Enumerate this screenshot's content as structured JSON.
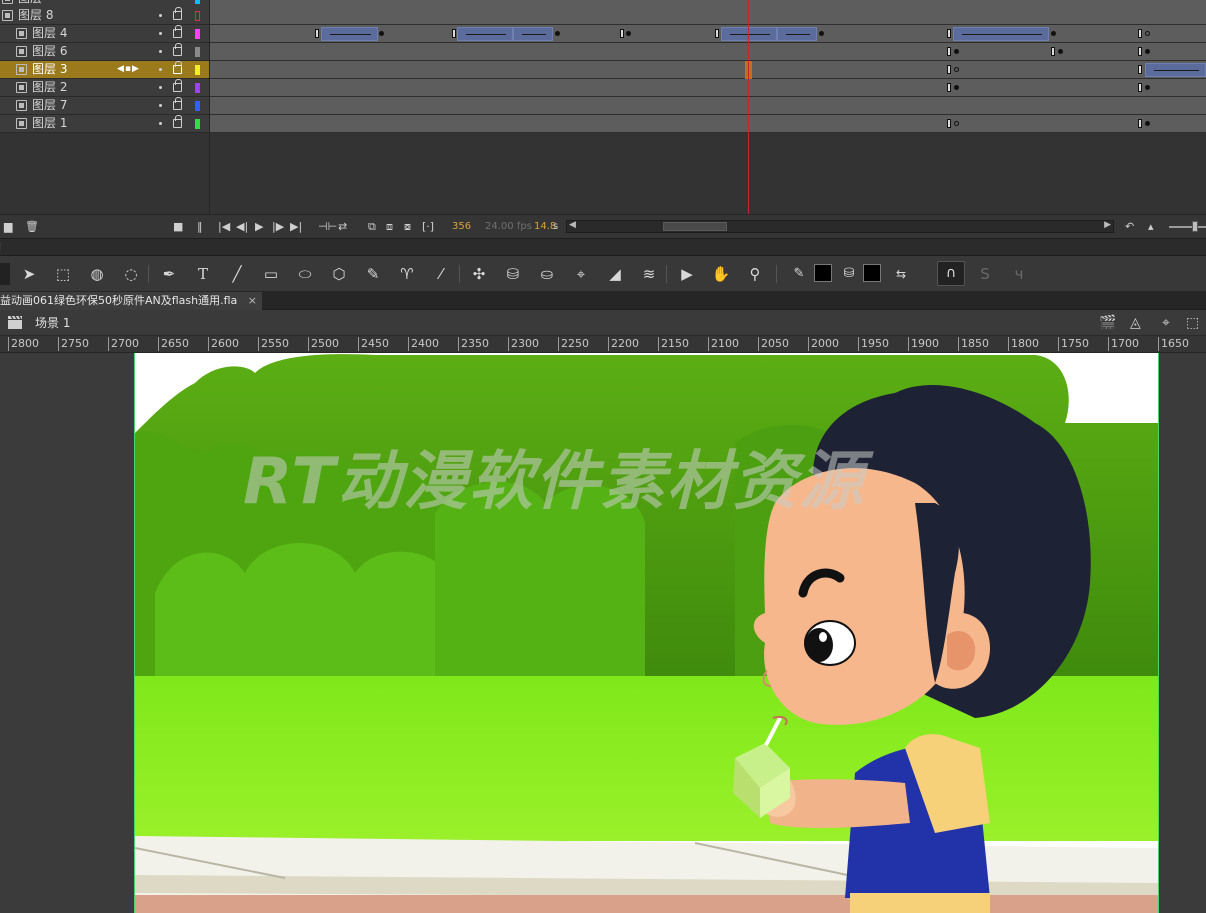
{
  "layers": [
    {
      "name": "图层",
      "color": "#00c0ff"
    },
    {
      "name": "图层 8",
      "color": "#e0303a"
    },
    {
      "name": "图层 4",
      "color": "#ff40ff"
    },
    {
      "name": "图层 6",
      "color": "#8a8a8a"
    },
    {
      "name": "图层 3",
      "color": "#f0f020"
    },
    {
      "name": "图层 2",
      "color": "#a040ff"
    },
    {
      "name": "图层 7",
      "color": "#3060ff"
    },
    {
      "name": "图层 1",
      "color": "#30e040"
    }
  ],
  "timeline": {
    "current_frame": "356",
    "fps": "24.00 fps",
    "time": "14.8",
    "time_unit": "s"
  },
  "document": {
    "tab_title": "益动画061绿色环保50秒原件AN及flash通用.fla",
    "close_glyph": "×"
  },
  "scene": {
    "label": "场景 1"
  },
  "ruler": {
    "ticks": [
      "2800",
      "2750",
      "2700",
      "2650",
      "2600",
      "2550",
      "2500",
      "2450",
      "2400",
      "2350",
      "2300",
      "2250",
      "2200",
      "2150",
      "2100",
      "2050",
      "2000",
      "1950",
      "1900",
      "1850",
      "1800",
      "1750",
      "1700",
      "1650"
    ]
  },
  "watermark": "RT动漫软件素材资源",
  "toolbar": {
    "tools": [
      "selection-tool",
      "subselection-tool",
      "3d-rotation-tool",
      "lasso-tool",
      "pen-tool",
      "text-tool",
      "line-tool",
      "rectangle-tool",
      "oval-tool",
      "polystar-tool",
      "pencil-tool",
      "brush-tool",
      "paint-brush-tool",
      "bone-tool",
      "paint-bucket-tool",
      "ink-bottle-tool",
      "eyedropper-tool",
      "eraser-tool",
      "width-tool",
      "camera-tool",
      "hand-tool",
      "zoom-tool"
    ],
    "stroke_color": "#000000",
    "fill_color": "#000000"
  },
  "colors": {
    "selected_layer": "#9b7a1c",
    "playhead": "#c1272d",
    "tween": "#5a6b9c",
    "frame_counter": "#d9a23a"
  }
}
